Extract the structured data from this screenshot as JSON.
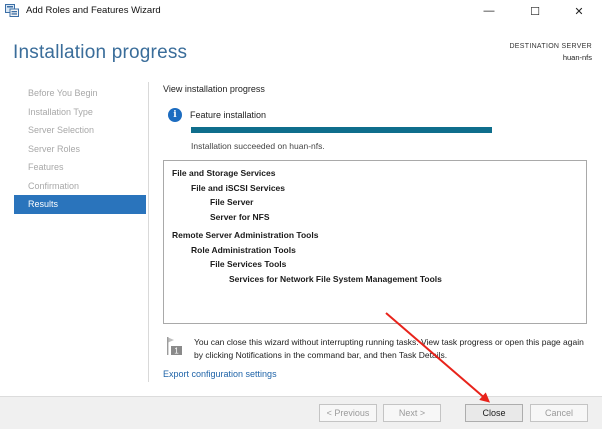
{
  "window": {
    "title": "Add Roles and Features Wizard",
    "minimize_glyph": "—",
    "maximize_glyph": "☐",
    "close_glyph": "✕"
  },
  "header": {
    "page_title": "Installation progress",
    "destination_label": "DESTINATION SERVER",
    "destination_server": "huan-nfs"
  },
  "nav": {
    "items": [
      {
        "label": "Before You Begin",
        "active": false
      },
      {
        "label": "Installation Type",
        "active": false
      },
      {
        "label": "Server Selection",
        "active": false
      },
      {
        "label": "Server Roles",
        "active": false
      },
      {
        "label": "Features",
        "active": false
      },
      {
        "label": "Confirmation",
        "active": false
      },
      {
        "label": "Results",
        "active": true
      }
    ]
  },
  "main": {
    "section_label": "View installation progress",
    "feature_label": "Feature installation",
    "progress": 1.0,
    "success_message": "Installation succeeded on huan-nfs.",
    "results": {
      "group1": {
        "l1": "File and Storage Services",
        "l2": "File and iSCSI Services",
        "l3a": "File Server",
        "l3b": "Server for NFS"
      },
      "group2": {
        "l1": "Remote Server Administration Tools",
        "l2": "Role Administration Tools",
        "l3": "File Services Tools",
        "l4": "Services for Network File System Management Tools"
      }
    },
    "notice_text": "You can close this wizard without interrupting running tasks. View task progress or open this page again by clicking Notifications in the command bar, and then Task Details.",
    "notice_badge": "1",
    "export_link": "Export configuration settings"
  },
  "footer": {
    "previous_label": "< Previous",
    "next_label": "Next >",
    "close_label": "Close",
    "cancel_label": "Cancel"
  },
  "colors": {
    "accent": "#2a74bc",
    "progress": "#0f6e8c",
    "annotation_arrow": "#e8231b"
  },
  "icons": {
    "app": "server-manager-icon",
    "info": "info-icon",
    "notice": "notification-flag-icon"
  }
}
